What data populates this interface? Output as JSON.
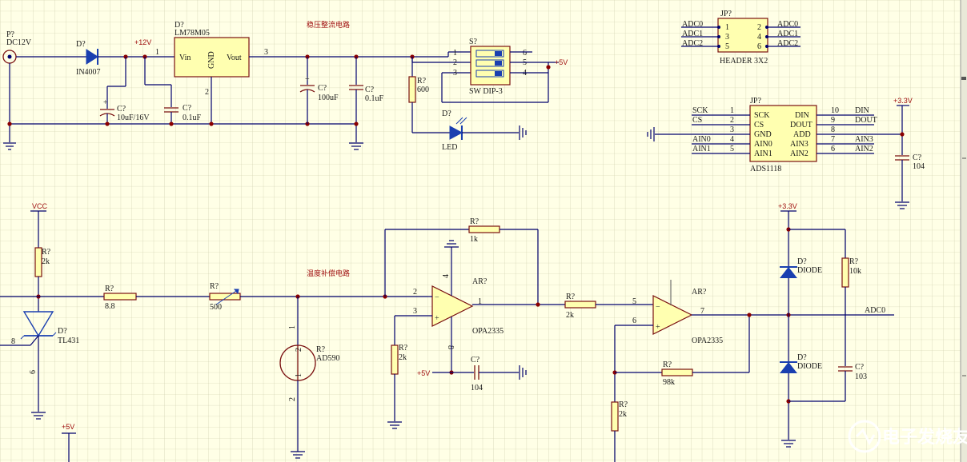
{
  "sections": {
    "power": "稳压整流电路",
    "temp": "温度补偿电路"
  },
  "nets": {
    "p12": "+12V",
    "p5a": "+5V",
    "p5b": "+5V",
    "p5c": "+5V",
    "p33a": "+3.3V",
    "p33b": "+3.3V",
    "vcc": "VCC",
    "adc0": "ADC0"
  },
  "power": {
    "p_ref": "P?",
    "p_val": "DC12V",
    "d1_ref": "D?",
    "d1_val": "IN4007",
    "u_ref": "D?",
    "u_val": "LM78M05",
    "u_vin": "Vin",
    "u_gnd": "GND",
    "u_vout": "Vout",
    "u_p1": "1",
    "u_p2": "2",
    "u_p3": "3",
    "c1_ref": "C?",
    "c1_val": "10uF/16V",
    "c2_ref": "C?",
    "c2_val": "0.1uF",
    "c3_ref": "C?",
    "c3_val": "100uF",
    "c4_ref": "C?",
    "c4_val": "0.1uF",
    "r_ref": "R?",
    "r_val": "600",
    "sw_ref": "S?",
    "sw_val": "SW DIP-3",
    "sw_pins": [
      "1",
      "2",
      "3",
      "6",
      "5",
      "4"
    ],
    "led_ref": "D?",
    "led_val": "LED"
  },
  "header": {
    "ref": "JP?",
    "val": "HEADER 3X2",
    "left_nets": [
      "ADC0",
      "ADC1",
      "ADC2"
    ],
    "right_nets": [
      "ADC0",
      "ADC1",
      "ADC2"
    ],
    "left_pins": [
      "1",
      "3",
      "5"
    ],
    "right_pins": [
      "2",
      "4",
      "6"
    ]
  },
  "ads": {
    "ref": "JP?",
    "val": "ADS1118",
    "left_pins": [
      "SCK",
      "CS",
      "GND",
      "AIN0",
      "AIN1"
    ],
    "right_pins": [
      "DIN",
      "DOUT",
      "ADD",
      "AIN3",
      "AIN2"
    ],
    "left_nums": [
      "1",
      "2",
      "3",
      "4",
      "5"
    ],
    "right_nums": [
      "10",
      "9",
      "8",
      "7",
      "6"
    ],
    "left_nets": [
      "SCK",
      "CS",
      "",
      "AIN0",
      "AIN1"
    ],
    "right_nets": [
      "DIN",
      "DOUT",
      "",
      "AIN3",
      "AIN2"
    ],
    "c_ref": "C?",
    "c_val": "104"
  },
  "temp": {
    "r1_ref": "R?",
    "r1_val": "2k",
    "tl_ref": "D?",
    "tl_val": "TL431",
    "tl_p8": "8",
    "tl_p6": "6",
    "r2_ref": "R?",
    "r2_val": "8.8",
    "r3_ref": "R?",
    "r3_val": "500",
    "ad_ref": "R?",
    "ad_val": "AD590",
    "ad_p1": "1",
    "ad_p2": "2",
    "ad_p2b": "2",
    "op1_ref": "AR?",
    "op1_val": "OPA2335",
    "op1_p2": "2",
    "op1_p3": "3",
    "op1_p4": "4",
    "op1_p1": "1",
    "op1_p8": "8",
    "rf_ref": "R?",
    "rf_val": "1k",
    "rg_ref": "R?",
    "rg_val": "2k",
    "c_ref": "C?",
    "c_val": "104",
    "r5_ref": "R?",
    "r5_val": "2k",
    "op2_ref": "AR?",
    "op2_val": "OPA2335",
    "op2_p5": "5",
    "op2_p6": "6",
    "op2_p7": "7",
    "r6_ref": "R?",
    "r6_val": "98k",
    "r7_ref": "R?",
    "r7_val": "2k",
    "d1_ref": "D?",
    "d1_val": "DIODE",
    "d2_ref": "D?",
    "d2_val": "DIODE",
    "r8_ref": "R?",
    "r8_val": "10k",
    "c2_ref": "C?",
    "c2_val": "103"
  },
  "watermark": "电子发烧友"
}
